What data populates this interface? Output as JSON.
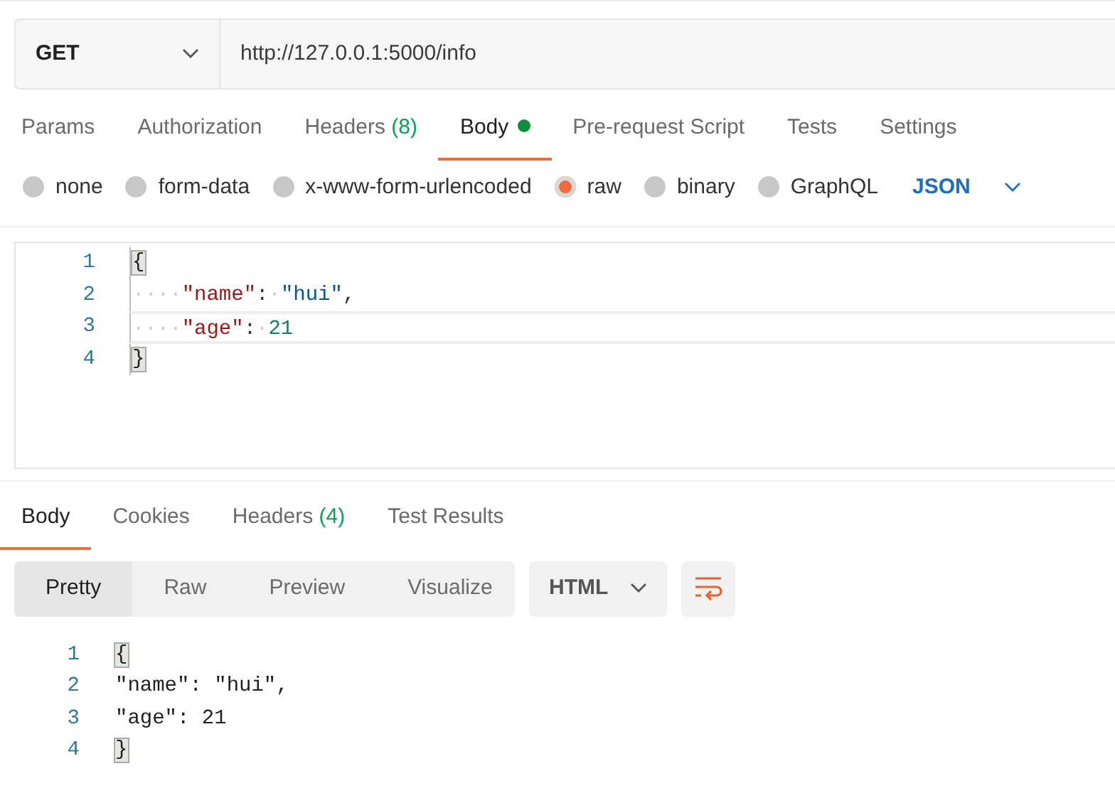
{
  "request": {
    "method": "GET",
    "url": "http://127.0.0.1:5000/info"
  },
  "request_tabs": [
    {
      "label": "Params",
      "selected": false
    },
    {
      "label": "Authorization",
      "selected": false
    },
    {
      "label": "Headers",
      "count": "(8)",
      "selected": false
    },
    {
      "label": "Body",
      "dot": true,
      "selected": true
    },
    {
      "label": "Pre-request Script",
      "selected": false
    },
    {
      "label": "Tests",
      "selected": false
    },
    {
      "label": "Settings",
      "selected": false
    }
  ],
  "body_types": [
    {
      "label": "none",
      "selected": false
    },
    {
      "label": "form-data",
      "selected": false
    },
    {
      "label": "x-www-form-urlencoded",
      "selected": false
    },
    {
      "label": "raw",
      "selected": true
    },
    {
      "label": "binary",
      "selected": false
    },
    {
      "label": "GraphQL",
      "selected": false
    }
  ],
  "body_format": "JSON",
  "request_body": [
    {
      "number": "1",
      "current": false,
      "tokens": [
        {
          "kind": "brace",
          "text": "{"
        }
      ]
    },
    {
      "number": "2",
      "current": false,
      "tokens": [
        {
          "kind": "ws",
          "text": "····"
        },
        {
          "kind": "key",
          "text": "\"name\""
        },
        {
          "kind": "punct",
          "text": ":"
        },
        {
          "kind": "ws",
          "text": "·"
        },
        {
          "kind": "string",
          "text": "\"hui\""
        },
        {
          "kind": "punct",
          "text": ","
        }
      ]
    },
    {
      "number": "3",
      "current": true,
      "tokens": [
        {
          "kind": "ws",
          "text": "····"
        },
        {
          "kind": "key",
          "text": "\"age\""
        },
        {
          "kind": "punct",
          "text": ":"
        },
        {
          "kind": "ws",
          "text": "·"
        },
        {
          "kind": "number",
          "text": "21"
        }
      ]
    },
    {
      "number": "4",
      "current": false,
      "tokens": [
        {
          "kind": "brace",
          "text": "}"
        }
      ]
    }
  ],
  "response_tabs": [
    {
      "label": "Body",
      "selected": true
    },
    {
      "label": "Cookies",
      "selected": false
    },
    {
      "label": "Headers",
      "count": "(4)",
      "selected": false
    },
    {
      "label": "Test Results",
      "selected": false
    }
  ],
  "view_modes": [
    {
      "label": "Pretty",
      "selected": true
    },
    {
      "label": "Raw",
      "selected": false
    },
    {
      "label": "Preview",
      "selected": false
    },
    {
      "label": "Visualize",
      "selected": false
    }
  ],
  "response_format": "HTML",
  "response_body": [
    {
      "number": "1",
      "tokens": [
        {
          "kind": "brace",
          "text": "{"
        }
      ]
    },
    {
      "number": "2",
      "tokens": [
        {
          "kind": "plain",
          "text": "\"name\": \"hui\","
        }
      ]
    },
    {
      "number": "3",
      "tokens": [
        {
          "kind": "plain",
          "text": "\"age\": 21"
        }
      ]
    },
    {
      "number": "4",
      "tokens": [
        {
          "kind": "brace",
          "text": "}"
        }
      ]
    }
  ]
}
